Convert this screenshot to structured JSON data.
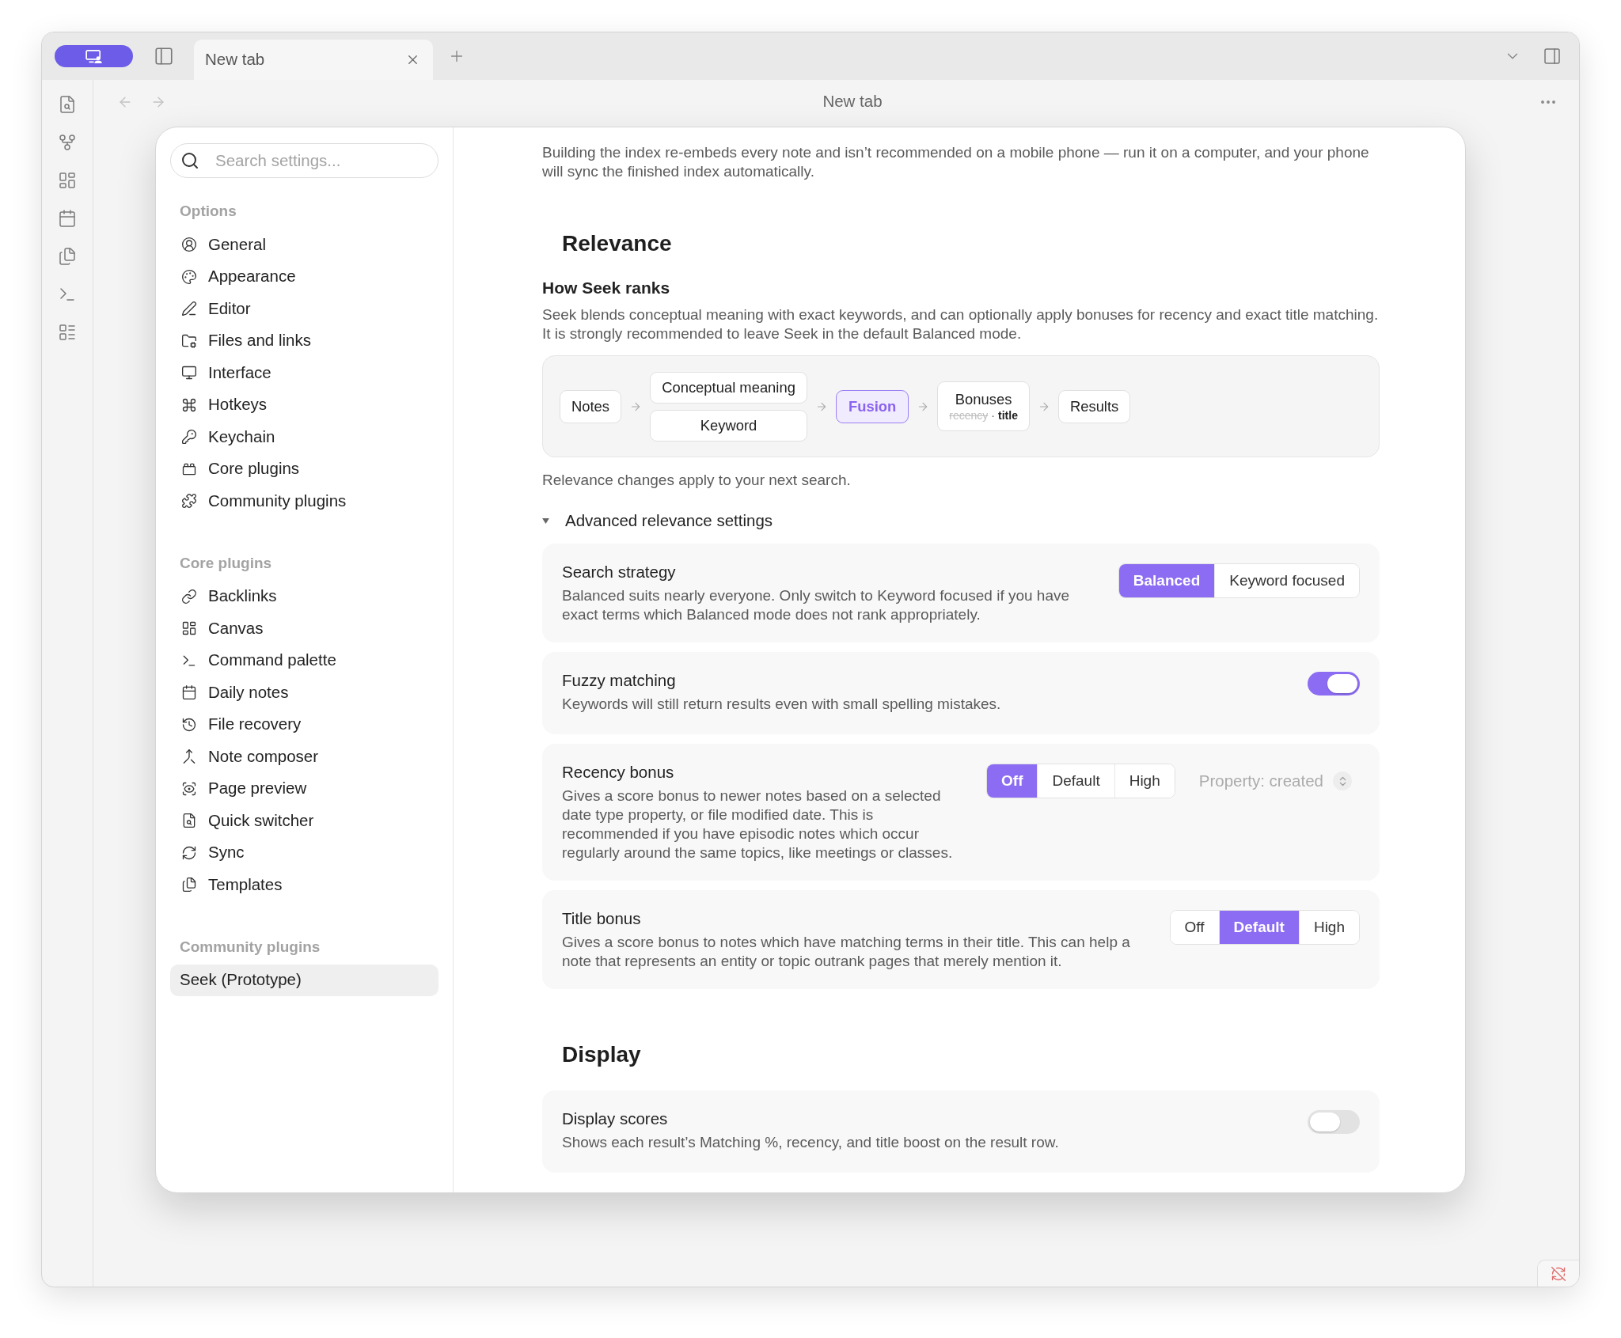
{
  "titlebar": {
    "tabs": [
      {
        "label": "New tab",
        "selected": true
      }
    ]
  },
  "nav": {
    "title": "New tab"
  },
  "settings_sidebar": {
    "search": {
      "placeholder": "Search settings..."
    },
    "sections": [
      {
        "heading": "Options",
        "items": [
          {
            "label": "General",
            "selected": false
          },
          {
            "label": "Appearance",
            "selected": false
          },
          {
            "label": "Editor",
            "selected": false
          },
          {
            "label": "Files and links",
            "selected": false
          },
          {
            "label": "Interface",
            "selected": false
          },
          {
            "label": "Hotkeys",
            "selected": false
          },
          {
            "label": "Keychain",
            "selected": false
          },
          {
            "label": "Core plugins",
            "selected": false
          },
          {
            "label": "Community plugins",
            "selected": false
          }
        ]
      },
      {
        "heading": "Core plugins",
        "items": [
          {
            "label": "Backlinks",
            "selected": false
          },
          {
            "label": "Canvas",
            "selected": false
          },
          {
            "label": "Command palette",
            "selected": false
          },
          {
            "label": "Daily notes",
            "selected": false
          },
          {
            "label": "File recovery",
            "selected": false
          },
          {
            "label": "Note composer",
            "selected": false
          },
          {
            "label": "Page preview",
            "selected": false
          },
          {
            "label": "Quick switcher",
            "selected": false
          },
          {
            "label": "Sync",
            "selected": false
          },
          {
            "label": "Templates",
            "selected": false
          }
        ]
      },
      {
        "heading": "Community plugins",
        "items": [
          {
            "label": "Seek (Prototype)",
            "selected": true
          }
        ]
      }
    ]
  },
  "content": {
    "intro": "Building the index re-embeds every note and isn’t recommended on a mobile phone — run it on a computer, and your phone will sync the finished index automatically.",
    "sections": [
      {
        "heading": "Relevance",
        "blocks": [
          {
            "kind": "subheading",
            "text": "How Seek ranks"
          },
          {
            "kind": "paragraph",
            "text": "Seek blends conceptual meaning with exact keywords, and can optionally apply bonuses for recency and exact title matching. It is strongly recommended to leave Seek in the default Balanced mode."
          },
          {
            "kind": "pipeline",
            "stages": [
              {
                "kind": "node",
                "label": "Notes"
              },
              {
                "kind": "stack",
                "labels": [
                  "Conceptual meaning",
                  "Keyword"
                ]
              },
              {
                "kind": "accent",
                "label": "Fusion"
              },
              {
                "kind": "bonus",
                "label": "Bonuses",
                "separator": "·",
                "parts": [
                  {
                    "text": "recency",
                    "on": false
                  },
                  {
                    "text": "title",
                    "on": true
                  }
                ]
              },
              {
                "kind": "node",
                "label": "Results"
              }
            ]
          },
          {
            "kind": "paragraph",
            "text": "Relevance changes apply to your next search."
          },
          {
            "kind": "group",
            "label": "Advanced relevance settings",
            "expanded": true,
            "settings": [
              {
                "kind": "segmented",
                "title": "Search strategy",
                "description": "Balanced suits nearly everyone. Only switch to Keyword focused if you have exact terms which Balanced mode does not rank appropriately.",
                "options": [
                  {
                    "label": "Balanced",
                    "selected": true
                  },
                  {
                    "label": "Keyword focused",
                    "selected": false
                  }
                ]
              },
              {
                "kind": "toggle",
                "title": "Fuzzy matching",
                "description": "Keywords will still return results even with small spelling mistakes.",
                "on": true
              },
              {
                "kind": "segmented",
                "title": "Recency bonus",
                "description": "Gives a score bonus to newer notes based on a selected date type property, or file modified date. This is recommended if you have episodic notes which occur regularly around the same topics, like meetings or classes.",
                "options": [
                  {
                    "label": "Off",
                    "selected": true
                  },
                  {
                    "label": "Default",
                    "selected": false
                  },
                  {
                    "label": "High",
                    "selected": false
                  }
                ],
                "select": {
                  "value": "Property: created",
                  "disabled": true
                }
              },
              {
                "kind": "segmented",
                "title": "Title bonus",
                "description": "Gives a score bonus to notes which have matching terms in their title. This can help a note that represents an entity or topic outrank pages that merely mention it.",
                "options": [
                  {
                    "label": "Off",
                    "selected": false
                  },
                  {
                    "label": "Default",
                    "selected": true
                  },
                  {
                    "label": "High",
                    "selected": false
                  }
                ]
              }
            ]
          }
        ]
      },
      {
        "heading": "Display",
        "blocks": [
          {
            "kind": "settings",
            "settings": [
              {
                "kind": "toggle",
                "title": "Display scores",
                "description": "Shows each result’s Matching %, recency, and title boost on the result row.",
                "on": false
              }
            ]
          }
        ]
      }
    ]
  }
}
